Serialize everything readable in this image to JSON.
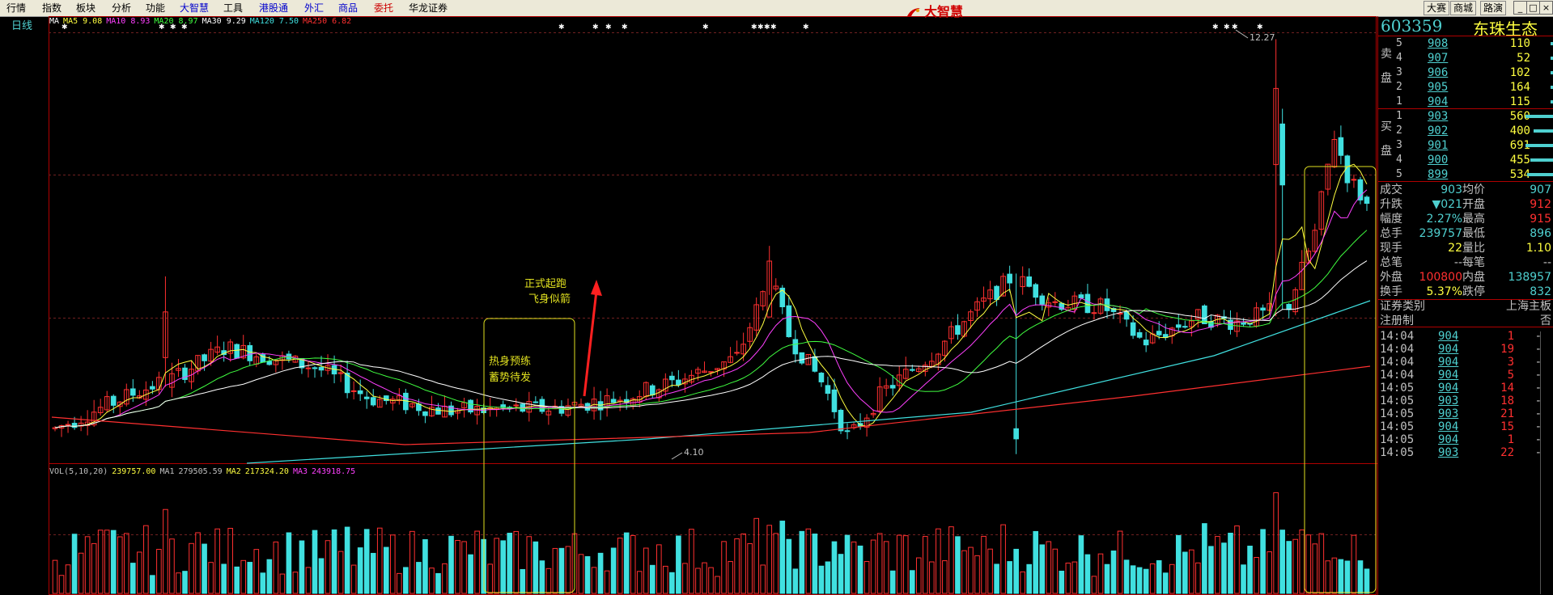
{
  "menu": {
    "items": [
      {
        "label": "行情",
        "color": "black"
      },
      {
        "label": "指数",
        "color": "black"
      },
      {
        "label": "板块",
        "color": "black"
      },
      {
        "label": "分析",
        "color": "black"
      },
      {
        "label": "功能",
        "color": "black"
      },
      {
        "label": "大智慧",
        "color": "blue"
      },
      {
        "label": "工具",
        "color": "black"
      },
      {
        "label": "港股通",
        "color": "blue"
      },
      {
        "label": "外汇",
        "color": "blue"
      },
      {
        "label": "商品",
        "color": "blue"
      },
      {
        "label": "委托",
        "color": "red"
      },
      {
        "label": "华龙证券",
        "color": "black"
      }
    ],
    "brand": "大智慧",
    "right_buttons": [
      "大赛",
      "商城",
      "路演"
    ],
    "window_buttons": [
      "_",
      "□",
      "×"
    ]
  },
  "chart": {
    "period_label": "日线",
    "ma_legend": [
      {
        "label": "MA",
        "color": "#ffffff"
      },
      {
        "label": "MA5 9.08",
        "color": "#ffff40"
      },
      {
        "label": "MA10 8.93",
        "color": "#ff40ff"
      },
      {
        "label": "MA20 8.97",
        "color": "#40ff40"
      },
      {
        "label": "MA30 9.29",
        "color": "#ffffff"
      },
      {
        "label": "MA120 7.50",
        "color": "#40e0e0"
      },
      {
        "label": "MA250 6.82",
        "color": "#ff3030"
      }
    ],
    "vol_legend": [
      {
        "label": "VOL(5,10,20)",
        "color": "#c0c0c0"
      },
      {
        "label": "239757.00",
        "color": "#ffff40"
      },
      {
        "label": "MA1",
        "color": "#c0c0c0"
      },
      {
        "label": "279505.59",
        "color": "#c0c0c0"
      },
      {
        "label": "MA2",
        "color": "#ffff40"
      },
      {
        "label": "217324.20",
        "color": "#ffff40"
      },
      {
        "label": "MA3",
        "color": "#ff40ff"
      },
      {
        "label": "243918.75",
        "color": "#ff40ff"
      }
    ],
    "annotations": {
      "high_price": "12.27",
      "low_price": "4.10",
      "box1_text": [
        "热身预练",
        "蓄势待发"
      ],
      "arrow_text": [
        "正式起跑",
        "飞身似箭"
      ]
    },
    "colors": {
      "up": "#ff3030",
      "down": "#40e0e0",
      "border": "#b00000",
      "highlight": "#e0e020"
    }
  },
  "chart_data": {
    "type": "candlestick",
    "title": "",
    "ylim": [
      4.0,
      12.5
    ],
    "high": 12.27,
    "low": 4.1,
    "indicators": {
      "MA5": 9.08,
      "MA10": 8.93,
      "MA20": 8.97,
      "MA30": 9.29,
      "MA120": 7.5,
      "MA250": 6.82
    },
    "volume": {
      "VOL": 239757.0,
      "MA1": 279505.59,
      "MA2": 217324.2,
      "MA3": 243918.75
    }
  },
  "quote": {
    "code": "603359",
    "name": "东珠生态",
    "sell_label": [
      "卖",
      "盘"
    ],
    "buy_label": [
      "买",
      "盘"
    ],
    "sell": [
      {
        "level": "5",
        "price": "908",
        "volume": "110",
        "bar": 0.0
      },
      {
        "level": "4",
        "price": "907",
        "volume": "52",
        "bar": 0.0
      },
      {
        "level": "3",
        "price": "906",
        "volume": "102",
        "bar": 0.0
      },
      {
        "level": "2",
        "price": "905",
        "volume": "164",
        "bar": 0.0
      },
      {
        "level": "1",
        "price": "904",
        "volume": "115",
        "bar": 0.0
      }
    ],
    "buy": [
      {
        "level": "1",
        "price": "903",
        "volume": "560",
        "bar": 1.0
      },
      {
        "level": "2",
        "price": "902",
        "volume": "400",
        "bar": 0.71
      },
      {
        "level": "3",
        "price": "901",
        "volume": "691",
        "bar": 1.0
      },
      {
        "level": "4",
        "price": "900",
        "volume": "455",
        "bar": 0.81
      },
      {
        "level": "5",
        "price": "899",
        "volume": "534",
        "bar": 0.95
      }
    ],
    "stats": [
      {
        "l1": "成交",
        "v1": "903",
        "c1": "#4fd0d0",
        "l2": "均价",
        "v2": "907",
        "c2": "#4fd0d0"
      },
      {
        "l1": "升跌",
        "v1": "▼021",
        "c1": "#4fd0d0",
        "l2": "开盘",
        "v2": "912",
        "c2": "#ff3030"
      },
      {
        "l1": "幅度",
        "v1": "2.27%",
        "c1": "#4fd0d0",
        "l2": "最高",
        "v2": "915",
        "c2": "#ff3030"
      },
      {
        "l1": "总手",
        "v1": "239757",
        "c1": "#4fd0d0",
        "l2": "最低",
        "v2": "896",
        "c2": "#4fd0d0"
      },
      {
        "l1": "现手",
        "v1": "22",
        "c1": "#ffff40",
        "l2": "量比",
        "v2": "1.10",
        "c2": "#ffff40"
      },
      {
        "l1": "总笔",
        "v1": "--",
        "c1": "#c0c0c0",
        "l2": "每笔",
        "v2": "--",
        "c2": "#c0c0c0"
      },
      {
        "l1": "外盘",
        "v1": "100800",
        "c1": "#ff3030",
        "l2": "内盘",
        "v2": "138957",
        "c2": "#4fd0d0"
      },
      {
        "l1": "换手",
        "v1": "5.37%",
        "c1": "#ffff40",
        "l2": "跌停",
        "v2": "832",
        "c2": "#4fd0d0"
      }
    ],
    "info": [
      {
        "label": "证券类别",
        "value": "上海主板"
      },
      {
        "label": "注册制",
        "value": "否"
      }
    ],
    "ticks": [
      {
        "time": "14:04",
        "price": "904",
        "vol": "1",
        "dir": "-"
      },
      {
        "time": "14:04",
        "price": "904",
        "vol": "19",
        "dir": "-"
      },
      {
        "time": "14:04",
        "price": "904",
        "vol": "3",
        "dir": "-"
      },
      {
        "time": "14:04",
        "price": "904",
        "vol": "5",
        "dir": "-"
      },
      {
        "time": "14:05",
        "price": "904",
        "vol": "14",
        "dir": "-"
      },
      {
        "time": "14:05",
        "price": "903",
        "vol": "18",
        "dir": "-"
      },
      {
        "time": "14:05",
        "price": "903",
        "vol": "21",
        "dir": "-"
      },
      {
        "time": "14:05",
        "price": "904",
        "vol": "15",
        "dir": "-"
      },
      {
        "time": "14:05",
        "price": "904",
        "vol": "1",
        "dir": "-"
      },
      {
        "time": "14:05",
        "price": "903",
        "vol": "22",
        "dir": "-"
      }
    ]
  }
}
